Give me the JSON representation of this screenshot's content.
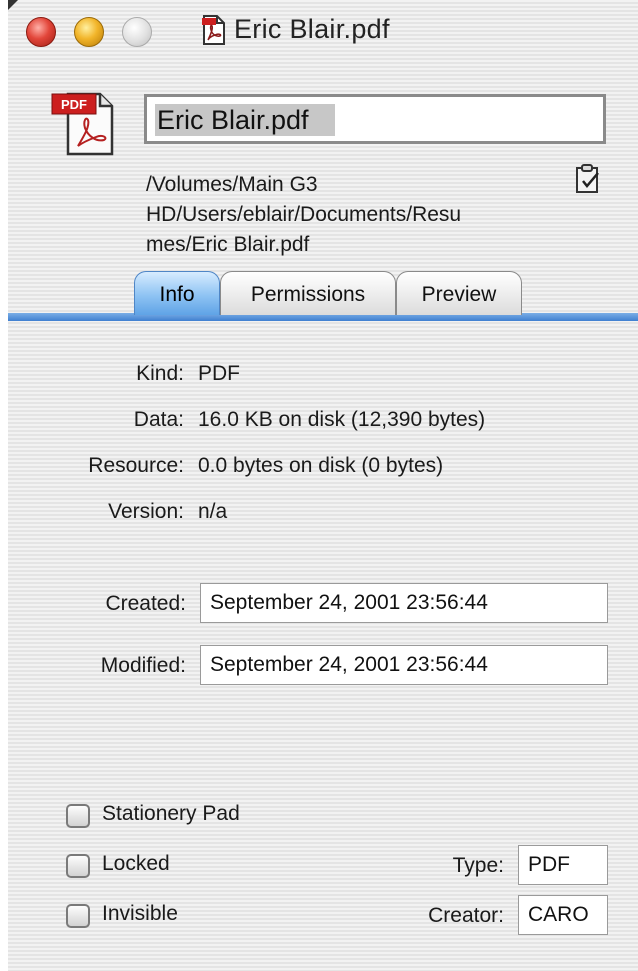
{
  "window": {
    "title": "Eric Blair.pdf"
  },
  "file": {
    "name": "Eric Blair.pdf",
    "icon_badge": "PDF",
    "path_lines": [
      "/Volumes/Main G3",
      "HD/Users/eblair/Documents/Resu",
      "mes/Eric Blair.pdf"
    ]
  },
  "tabs": [
    {
      "label": "Info",
      "active": true
    },
    {
      "label": "Permissions",
      "active": false
    },
    {
      "label": "Preview",
      "active": false
    }
  ],
  "info": {
    "kind_label": "Kind:",
    "kind_value": "PDF",
    "data_label": "Data:",
    "data_value": "16.0 KB on disk (12,390 bytes)",
    "resource_label": "Resource:",
    "resource_value": "0.0 bytes on disk (0 bytes)",
    "version_label": "Version:",
    "version_value": "n/a"
  },
  "dates": {
    "created_label": "Created:",
    "created_value": "September 24, 2001 23:56:44",
    "modified_label": "Modified:",
    "modified_value": "September 24, 2001 23:56:44"
  },
  "options": {
    "stationery_label": "Stationery Pad",
    "stationery_checked": false,
    "locked_label": "Locked",
    "locked_checked": false,
    "invisible_label": "Invisible",
    "invisible_checked": false
  },
  "codes": {
    "type_label": "Type:",
    "type_value": "PDF",
    "creator_label": "Creator:",
    "creator_value": "CARO"
  },
  "icons": {
    "close": "close-button-icon",
    "minimize": "minimize-button-icon",
    "zoom": "zoom-button-icon",
    "document": "pdf-document-icon",
    "clipboard": "clipboard-icon"
  },
  "colors": {
    "tab_accent": "#5fa3e6",
    "close": "#e2463a",
    "minimize": "#f2b52a",
    "pdf_badge": "#cc1f1f"
  }
}
